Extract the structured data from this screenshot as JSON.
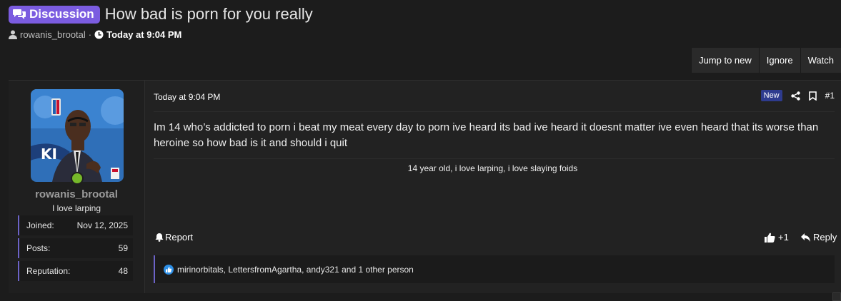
{
  "thread": {
    "prefix": "Discussion",
    "title": "How bad is porn for you really",
    "author": "rowanis_brootal",
    "separator": "·",
    "timestamp": "Today at 9:04 PM"
  },
  "actions": {
    "jump_to_new": "Jump to new",
    "ignore": "Ignore",
    "watch": "Watch"
  },
  "post": {
    "date": "Today at 9:04 PM",
    "new_badge": "New",
    "number": "#1",
    "message": "Im 14 who’s addicted to porn i beat my meat every day to porn ive heard its bad ive heard it doesnt matter ive even heard that its worse than heroine so how bad is it and should i quit",
    "signature": "14 year old, i love larping, i love slaying foids",
    "report_label": "Report",
    "react_count": "+1",
    "reply_label": "Reply",
    "reactions_text": "mirinorbitals, LettersfromAgartha, andy321 and 1 other person"
  },
  "user": {
    "username": "rowanis_brootal",
    "title": "I love larping",
    "stats": [
      {
        "label": "Joined:",
        "value": "Nov 12, 2025"
      },
      {
        "label": "Posts:",
        "value": "59"
      },
      {
        "label": "Reputation:",
        "value": "48"
      }
    ]
  },
  "colors": {
    "accent": "#7b5ce0",
    "stat_border": "#6c63c7",
    "online": "#76b82a",
    "new_badge": "#2e3b8e",
    "like": "#2d8fe6"
  },
  "icons": {
    "prefix": "comments-icon",
    "author": "user-icon",
    "time": "clock-icon",
    "share": "share-icon",
    "bookmark": "bookmark-icon",
    "report": "bell-icon",
    "react": "thumbs-up-icon",
    "reply": "reply-icon",
    "reaction": "like-badge-icon"
  }
}
